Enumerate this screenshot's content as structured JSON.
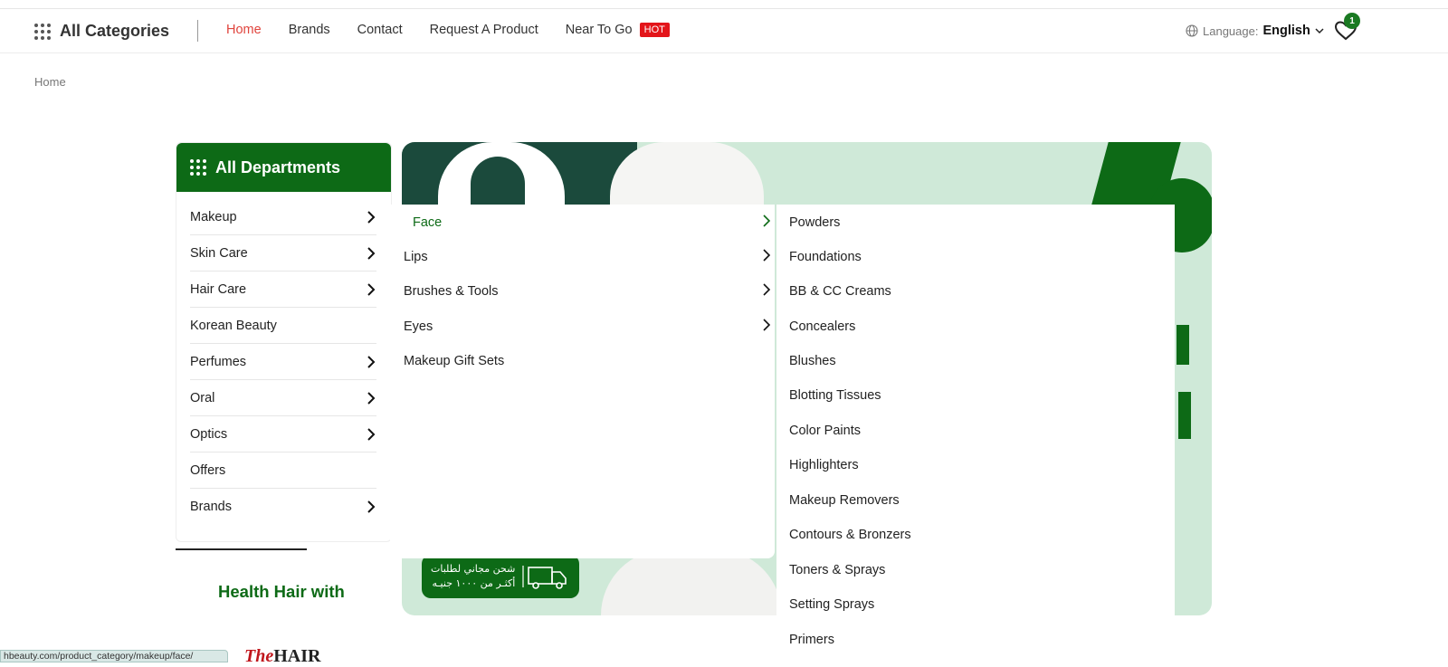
{
  "header": {
    "all_categories": "All Categories",
    "nav": [
      {
        "label": "Home",
        "active": true
      },
      {
        "label": "Brands"
      },
      {
        "label": "Contact"
      },
      {
        "label": "Request A Product"
      },
      {
        "label": "Near To Go"
      }
    ],
    "hot_badge": "HOT",
    "language_label": "Language:",
    "language_value": "English",
    "wishlist_count": "1"
  },
  "breadcrumb": "Home",
  "departments": {
    "title": "All Departments",
    "items": [
      {
        "label": "Makeup",
        "has_children": true
      },
      {
        "label": "Skin Care",
        "has_children": true
      },
      {
        "label": "Hair Care",
        "has_children": true
      },
      {
        "label": "Korean Beauty",
        "has_children": false
      },
      {
        "label": "Perfumes",
        "has_children": true
      },
      {
        "label": "Oral",
        "has_children": true
      },
      {
        "label": "Optics",
        "has_children": true
      },
      {
        "label": "Offers",
        "has_children": false
      },
      {
        "label": "Brands",
        "has_children": true
      }
    ]
  },
  "submenu": {
    "level2": [
      {
        "label": "Face",
        "has_children": true,
        "active": true
      },
      {
        "label": "Lips",
        "has_children": true
      },
      {
        "label": "Brushes & Tools",
        "has_children": true
      },
      {
        "label": "Eyes",
        "has_children": true
      },
      {
        "label": "Makeup Gift Sets",
        "has_children": false
      }
    ],
    "level3": [
      "Powders",
      "Foundations",
      "BB & CC Creams",
      "Concealers",
      "Blushes",
      "Blotting Tissues",
      "Color Paints",
      "Highlighters",
      "Makeup Removers",
      "Contours & Bronzers",
      "Toners & Sprays",
      "Setting Sprays",
      "Primers"
    ]
  },
  "banner": {
    "pill_line1": "شحن مجاني لطلبات",
    "pill_line2": "أكثـر من ١٠٠٠ جنيـه"
  },
  "section_heading": "Health Hair with",
  "brand_logo": {
    "prefix": "The",
    "name": "HAIR"
  },
  "status_url": "hbeauty.com/product_category/makeup/face/",
  "colors": {
    "brand_green": "#0d6a16",
    "active_nav": "#e0443d",
    "hot_red": "#e3151a"
  }
}
